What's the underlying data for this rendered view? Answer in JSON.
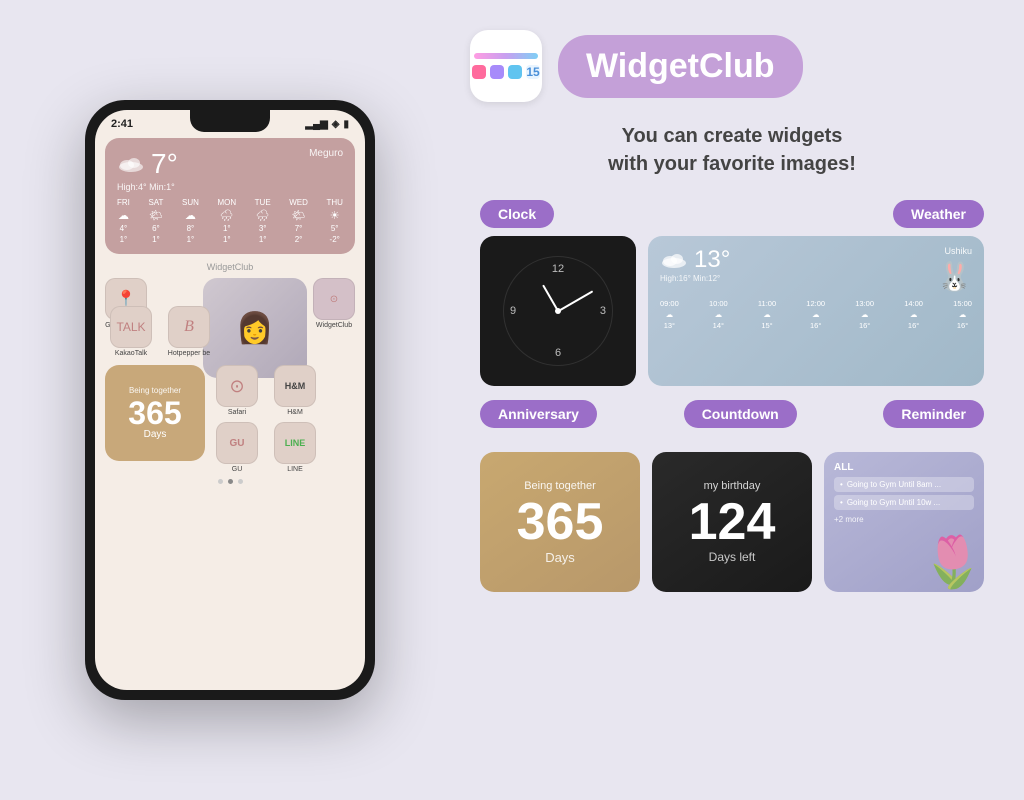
{
  "app": {
    "name": "WidgetClub",
    "tagline_line1": "You can create widgets",
    "tagline_line2": "with your favorite images!",
    "logo_number": "15"
  },
  "phone": {
    "time": "2:41",
    "weather_widget": {
      "temp": "7°",
      "high": "High:4°",
      "min": "Min:1°",
      "location": "Meguro",
      "days": [
        "FRI",
        "SAT",
        "SUN",
        "MON",
        "TUE",
        "WED",
        "THU"
      ],
      "temps_high": [
        "4°",
        "6°",
        "8°",
        "1°",
        "3°",
        "7°",
        "5°"
      ],
      "temps_low": [
        "1°",
        "1°",
        "1°",
        "1°",
        "1°",
        "2°",
        "-2°"
      ]
    },
    "widgetclub_label": "WidgetClub",
    "apps": [
      {
        "label": "Google Maps",
        "icon": "📍"
      },
      {
        "label": "KakaoTalk",
        "icon": "💬"
      },
      {
        "label": "Hotpepper be",
        "icon": "𝔅"
      },
      {
        "label": "WidgetClub",
        "icon": "⊙"
      },
      {
        "label": "Safari",
        "icon": "⊙"
      },
      {
        "label": "H&M",
        "icon": "H&M"
      },
      {
        "label": "GU",
        "icon": "GU"
      },
      {
        "label": "LINE",
        "icon": "LINE"
      }
    ],
    "anniversary_widget": {
      "text": "Being together",
      "number": "365",
      "label": "Days"
    }
  },
  "widget_sections": {
    "clock": {
      "label": "Clock"
    },
    "weather": {
      "label": "Weather",
      "temp": "13°",
      "location": "Ushiku",
      "high": "High:16°",
      "min": "Min:12°",
      "times": [
        "09:00",
        "10:00",
        "11:00",
        "12:00",
        "13:00",
        "14:00",
        "15:00"
      ],
      "temps": [
        "13°",
        "14°",
        "15°",
        "16°",
        "16°",
        "16°",
        "16°"
      ]
    },
    "anniversary": {
      "label": "Anniversary",
      "text": "Being together",
      "number": "365",
      "days_label": "Days"
    },
    "countdown": {
      "label": "Countdown",
      "text": "my birthday",
      "number": "124",
      "days_label": "Days left"
    },
    "reminder": {
      "label": "Reminder",
      "all_label": "ALL",
      "items": [
        "Going to Gym Until 8am ...",
        "Going to Gym Until 10w ..."
      ],
      "more": "+2 more"
    }
  }
}
